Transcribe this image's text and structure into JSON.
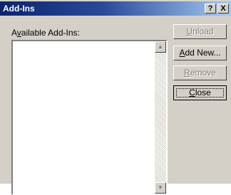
{
  "dialog": {
    "title": "Add-Ins",
    "help_button": "?",
    "close_button": "X"
  },
  "list": {
    "label": "Available Add-Ins:",
    "items": []
  },
  "buttons": {
    "unload": {
      "label": "Unload",
      "enabled": false
    },
    "add_new": {
      "label": "Add New...",
      "enabled": true
    },
    "remove": {
      "label": "Remove",
      "enabled": false
    },
    "close": {
      "label": "Close",
      "enabled": true,
      "default": true
    }
  },
  "icons": {
    "scroll_up": "triangle-up",
    "scroll_down": "triangle-down"
  }
}
